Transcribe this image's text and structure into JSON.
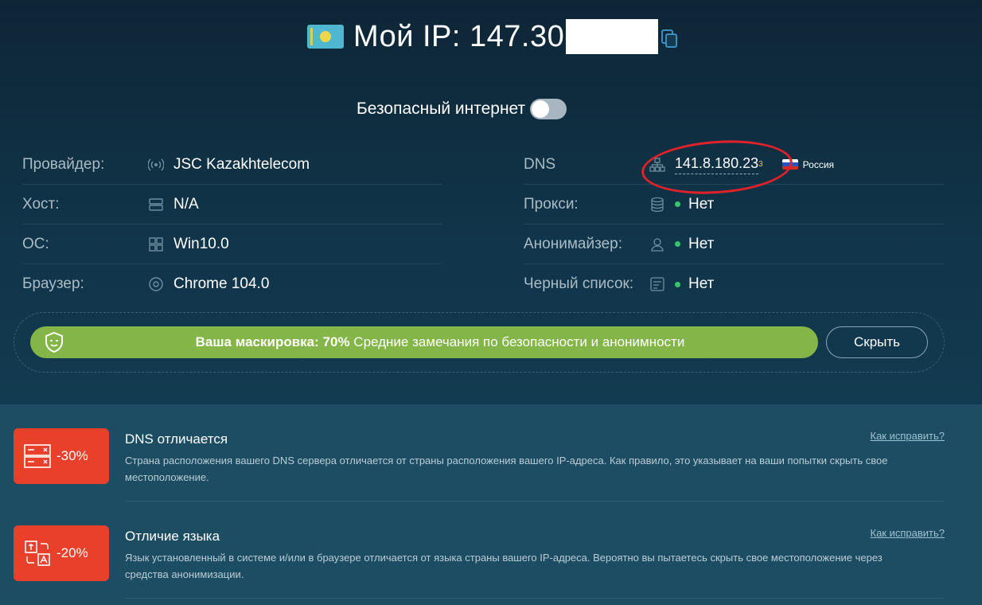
{
  "header": {
    "ip_label": "Мой IP: 147.30",
    "flag_icon": "kazakhstan-flag-icon",
    "copy_icon": "copy-icon"
  },
  "safe_internet": {
    "label": "Безопасный интернет",
    "enabled": false
  },
  "info_left": [
    {
      "label": "Провайдер:",
      "icon": "signal-icon",
      "value": "JSC Kazakhtelecom"
    },
    {
      "label": "Хост:",
      "icon": "server-icon",
      "value": "N/A"
    },
    {
      "label": "ОС:",
      "icon": "windows-icon",
      "value": "Win10.0"
    },
    {
      "label": "Браузер:",
      "icon": "chrome-icon",
      "value": "Chrome 104.0"
    }
  ],
  "info_right": {
    "dns": {
      "label": "DNS",
      "icon": "network-icon",
      "ip": "141.8.180.23",
      "count": "3",
      "country": "Россия"
    },
    "proxy": {
      "label": "Прокси:",
      "icon": "database-icon",
      "value": "Нет"
    },
    "anonymizer": {
      "label": "Анонимайзер:",
      "icon": "user-icon",
      "value": "Нет"
    },
    "blacklist": {
      "label": "Черный список:",
      "icon": "list-icon",
      "value": "Нет"
    }
  },
  "masking": {
    "prefix": "Ваша маскировка:",
    "percent": "70%",
    "suffix": "Средние замечания по безопасности и анонимности",
    "hide_button": "Скрыть",
    "colors": {
      "bar": "#84b548",
      "status_dot": "#3ac46a"
    }
  },
  "issues": [
    {
      "badge": "-30%",
      "title": "DNS отличается",
      "desc": "Страна расположения вашего DNS сервера отличается от страны расположения вашего IP-адреса. Как правило, это указывает на ваши попытки скрыть свое местоположение.",
      "link": "Как исправить?"
    },
    {
      "badge": "-20%",
      "title": "Отличие языка",
      "desc": "Язык установленный в системе и/или в браузере отличается от языка страны вашего IP-адреса. Вероятно вы пытаетесь скрыть свое местоположение через средства анонимизации.",
      "link": "Как исправить?"
    }
  ],
  "accent_colors": {
    "badge": "#e8402a",
    "annotation": "#e0222a"
  }
}
